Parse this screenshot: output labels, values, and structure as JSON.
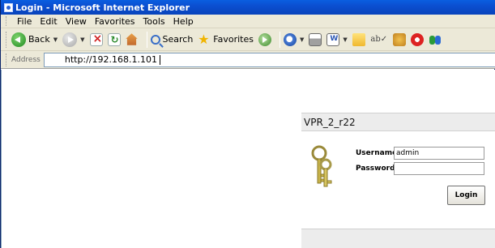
{
  "window": {
    "title": "Login - Microsoft Internet Explorer"
  },
  "menu": {
    "items": [
      "File",
      "Edit",
      "View",
      "Favorites",
      "Tools",
      "Help"
    ]
  },
  "toolbar": {
    "back_label": "Back",
    "search_label": "Search",
    "favorites_label": "Favorites",
    "buttons": [
      {
        "name": "back",
        "icon": "back-arrow-icon"
      },
      {
        "name": "forward",
        "icon": "forward-arrow-icon"
      },
      {
        "name": "stop",
        "icon": "stop-icon"
      },
      {
        "name": "refresh",
        "icon": "refresh-icon"
      },
      {
        "name": "home",
        "icon": "home-icon"
      },
      {
        "name": "search",
        "icon": "magnifier-icon"
      },
      {
        "name": "favorites",
        "icon": "star-icon"
      },
      {
        "name": "media",
        "icon": "media-icon"
      },
      {
        "name": "history",
        "icon": "history-icon"
      },
      {
        "name": "mail",
        "icon": "mail-icon"
      },
      {
        "name": "print",
        "icon": "printer-icon"
      },
      {
        "name": "edit",
        "icon": "word-edit-icon"
      },
      {
        "name": "folder",
        "icon": "folder-icon"
      },
      {
        "name": "spell",
        "icon": "spell-check-icon"
      },
      {
        "name": "research",
        "icon": "research-icon"
      },
      {
        "name": "messenger",
        "icon": "messenger-icon"
      },
      {
        "name": "people",
        "icon": "people-icon"
      }
    ],
    "spell_glyph": "ab✓"
  },
  "address": {
    "label": "Address",
    "url": "http://192.168.1.101"
  },
  "login_panel": {
    "header": "VPR_2_r22",
    "username_label": "Username:",
    "username_value": "admin",
    "password_label": "Password:",
    "password_value": "",
    "login_button": "Login",
    "keys_icon": "keys-icon"
  },
  "colors": {
    "titlebar": "#0b4fd1",
    "chrome": "#ece9d8",
    "panel_band": "#ececec"
  }
}
